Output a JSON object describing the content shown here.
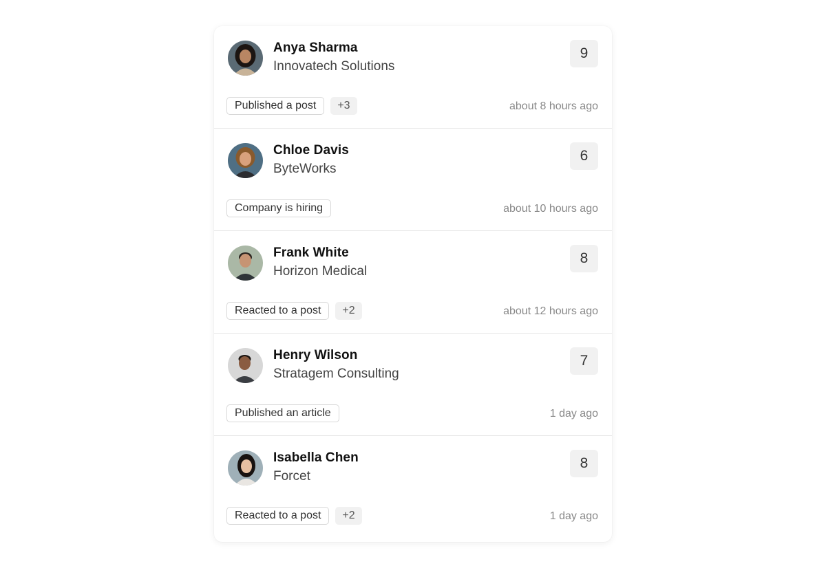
{
  "activities": [
    {
      "name": "Anya Sharma",
      "company": "Innovatech Solutions",
      "count": "9",
      "tag": "Published a post",
      "more": "+3",
      "time": "about 8 hours ago",
      "avatar": {
        "bg": "#5a6a74",
        "skin": "#b98663",
        "hair": "#1c1512",
        "shirt": "#c8b398"
      }
    },
    {
      "name": "Chloe Davis",
      "company": "ByteWorks",
      "count": "6",
      "tag": "Company is hiring",
      "more": "",
      "time": "about 10 hours ago",
      "avatar": {
        "bg": "#4f6f84",
        "skin": "#d9a17d",
        "hair": "#8a5a2c",
        "shirt": "#2c2c30"
      }
    },
    {
      "name": "Frank White",
      "company": "Horizon Medical",
      "count": "8",
      "tag": "Reacted to a post",
      "more": "+2",
      "time": "about 12 hours ago",
      "avatar": {
        "bg": "#aab8a6",
        "skin": "#c69474",
        "hair": "#2b2520",
        "shirt": "#2f3438"
      }
    },
    {
      "name": "Henry Wilson",
      "company": "Stratagem Consulting",
      "count": "7",
      "tag": "Published an article",
      "more": "",
      "time": "1 day ago",
      "avatar": {
        "bg": "#d7d7d7",
        "skin": "#8a5c41",
        "hair": "#1b1512",
        "shirt": "#3a3d42"
      }
    },
    {
      "name": "Isabella Chen",
      "company": "Forcet",
      "count": "8",
      "tag": "Reacted to a post",
      "more": "+2",
      "time": "1 day ago",
      "avatar": {
        "bg": "#9fb0b8",
        "skin": "#e6c0a2",
        "hair": "#181210",
        "shirt": "#e9e6e2"
      }
    }
  ]
}
